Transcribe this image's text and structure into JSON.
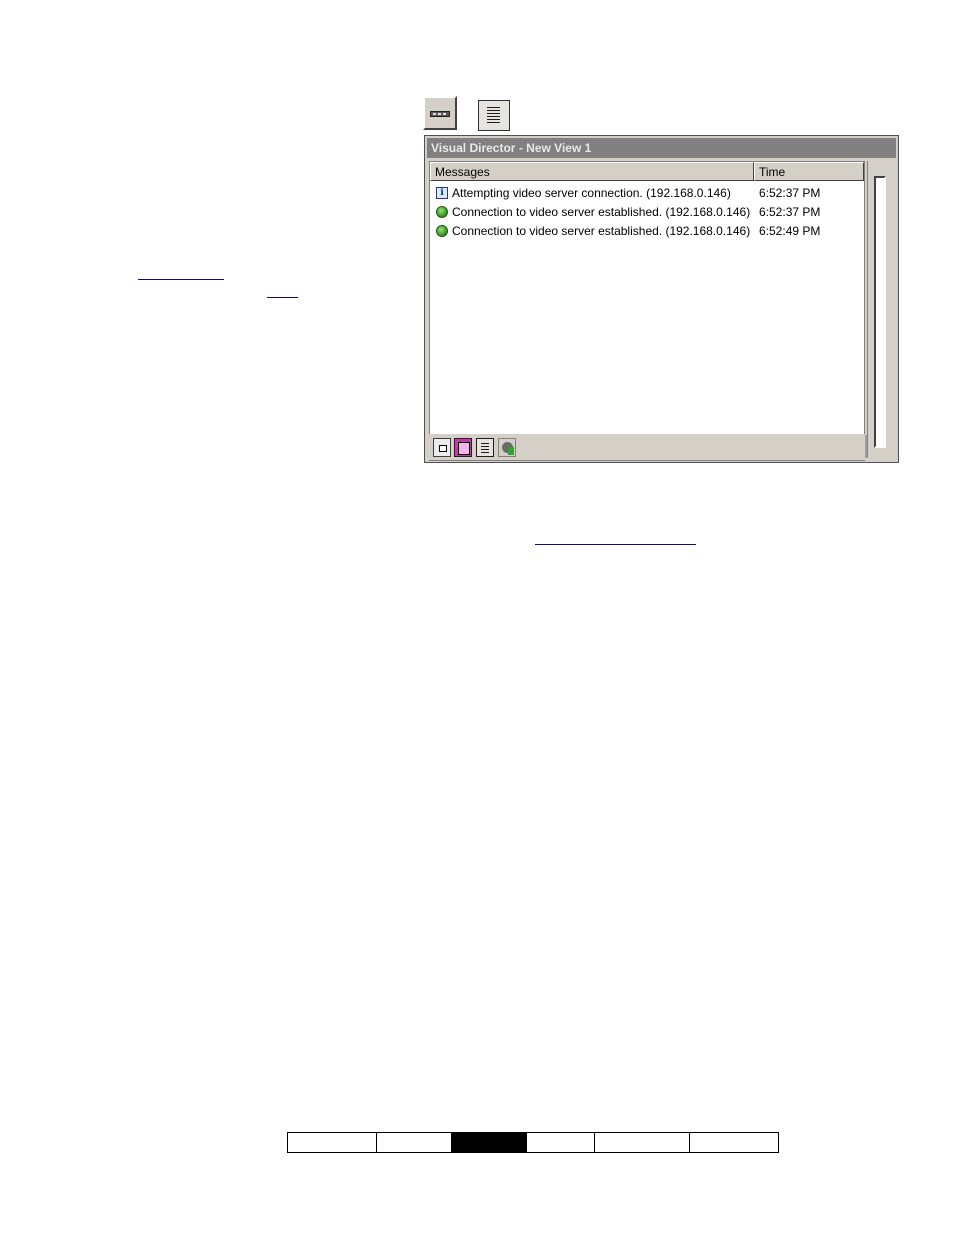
{
  "window": {
    "title": "Visual Director - New View 1"
  },
  "messages_panel": {
    "columns": {
      "messages": "Messages",
      "time": "Time"
    },
    "rows": [
      {
        "icon": "info-icon",
        "message": "Attempting video server connection. (192.168.0.146)",
        "time": "6:52:37 PM"
      },
      {
        "icon": "status-ok-icon",
        "message": "Connection to video server established. (192.168.0.146)",
        "time": "6:52:37 PM"
      },
      {
        "icon": "status-ok-icon",
        "message": "Connection to video server established. (192.168.0.146)",
        "time": "6:52:49 PM"
      }
    ],
    "status_ok_color": "#2f8f1f"
  },
  "footer_nav": {
    "cell_count": 6,
    "active_index": 2
  }
}
